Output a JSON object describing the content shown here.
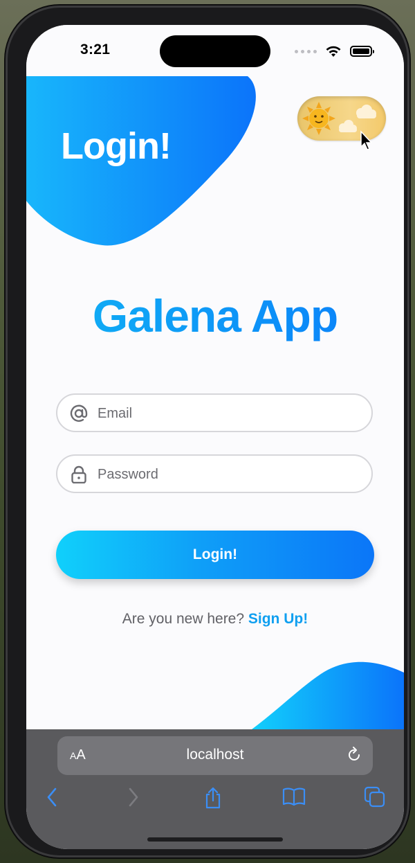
{
  "status_bar": {
    "time": "3:21"
  },
  "header": {
    "title": "Login!"
  },
  "theme_toggle": {
    "state": "light",
    "icon": "sun-face-icon"
  },
  "app": {
    "title": "Galena App"
  },
  "form": {
    "email": {
      "placeholder": "Email",
      "value": "",
      "icon": "at-icon"
    },
    "password": {
      "placeholder": "Password",
      "value": "",
      "icon": "lock-icon"
    },
    "submit_label": "Login!"
  },
  "signup": {
    "prompt": "Are you new here?",
    "link_label": "Sign Up!"
  },
  "browser": {
    "text_size_label": {
      "big": "A",
      "small": "A"
    },
    "url": "localhost",
    "icons": [
      "reload-icon",
      "back-icon",
      "forward-icon",
      "share-icon",
      "bookmarks-icon",
      "tabs-icon"
    ]
  },
  "colors": {
    "accent_start": "#10D0FB",
    "accent_end": "#0B76F8",
    "link": "#0F9FF0",
    "toolbar_bg": "#5A5A5D"
  }
}
